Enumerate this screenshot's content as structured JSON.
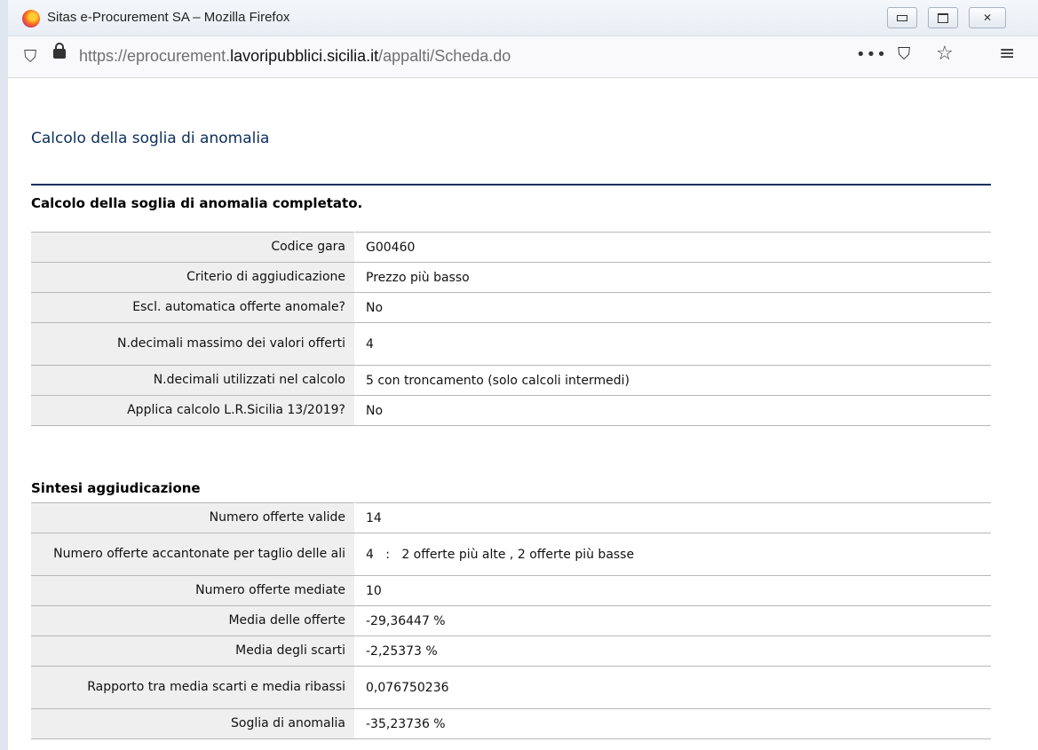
{
  "browser": {
    "window_title": "Sitas e-Procurement SA – Mozilla Firefox",
    "url_prefix": "https://eprocurement.",
    "url_domain": "lavoripubblici.sicilia.it",
    "url_path": "/appalti/Scheda.do",
    "more_glyph": "•••",
    "pocket_glyph": "⛉",
    "star_glyph": "☆",
    "menu_glyph": "≡",
    "shield_glyph": "⛉",
    "close_glyph": "✕"
  },
  "page": {
    "title": "Calcolo della soglia di anomalia",
    "completed_message": "Calcolo della soglia di anomalia completato.",
    "details": [
      {
        "label": "Codice gara",
        "value": "G00460"
      },
      {
        "label": "Criterio di aggiudicazione",
        "value": "Prezzo più basso"
      },
      {
        "label": "Escl. automatica offerte anomale?",
        "value": "No"
      },
      {
        "label": "N.decimali massimo dei valori offerti",
        "value": "4"
      },
      {
        "label": "N.decimali utilizzati nel calcolo",
        "value": "5 con troncamento (solo calcoli intermedi)"
      },
      {
        "label": "Applica calcolo L.R.Sicilia 13/2019?",
        "value": "No"
      }
    ],
    "summary_heading": "Sintesi aggiudicazione",
    "summary": [
      {
        "label": "Numero offerte valide",
        "value": "14"
      },
      {
        "label": "Numero offerte accantonate per taglio delle ali",
        "value": "4   :   2 offerte più alte , 2 offerte più basse"
      },
      {
        "label": "Numero offerte mediate",
        "value": "10"
      },
      {
        "label": "Media delle offerte",
        "value": "-29,36447 %"
      },
      {
        "label": "Media degli scarti",
        "value": "-2,25373 %"
      },
      {
        "label": "Rapporto tra media scarti e media ribassi",
        "value": "0,076750236"
      },
      {
        "label": "Soglia di anomalia",
        "value": "-35,23736 %"
      }
    ]
  }
}
